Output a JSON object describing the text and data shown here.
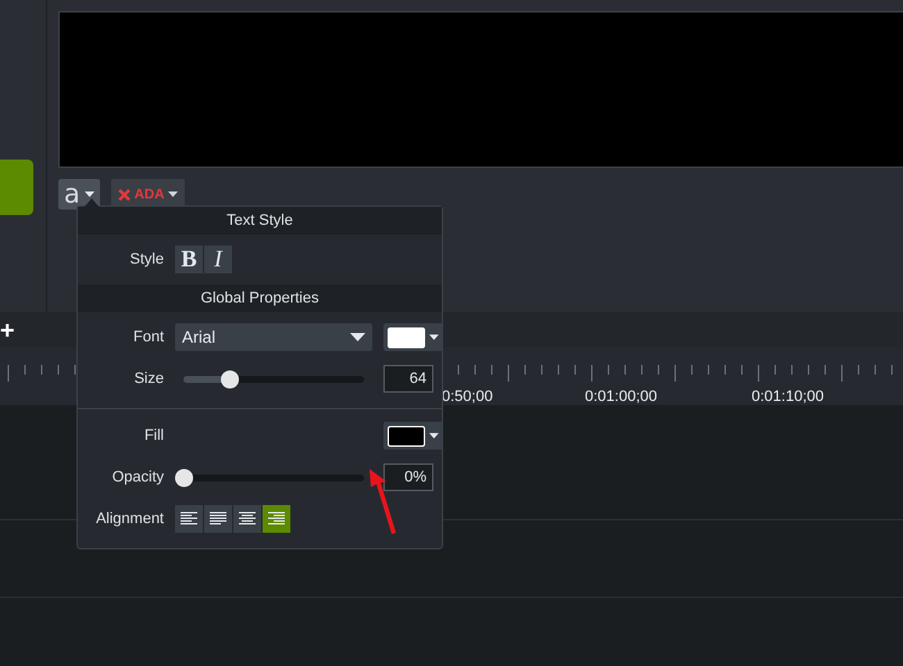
{
  "editor": {
    "annotation_button": {
      "label": "a"
    },
    "ada_button": {
      "label": "ADA"
    }
  },
  "timeline": {
    "add_label": "+",
    "ruler_labels": [
      "0:50;00",
      "0:01:00;00",
      "0:01:10;00"
    ]
  },
  "text_properties": {
    "text_style": {
      "title": "Text Style",
      "style_label": "Style",
      "style_buttons": [
        {
          "label": "B",
          "kind": "bold"
        },
        {
          "label": "I",
          "kind": "italic"
        }
      ]
    },
    "global_properties": {
      "title": "Global Properties",
      "font": {
        "label": "Font",
        "value": "Arial",
        "color": "#ffffff"
      },
      "size": {
        "label": "Size",
        "level": 0.25,
        "value": "64"
      },
      "fill": {
        "label": "Fill",
        "color": "#000000"
      },
      "opacity": {
        "label": "Opacity",
        "level": 0,
        "value": "0%"
      },
      "alignment": {
        "label": "Alignment",
        "options": [
          {
            "kind": "left",
            "selected": false
          },
          {
            "kind": "justify",
            "selected": false
          },
          {
            "kind": "center",
            "selected": false
          },
          {
            "kind": "right",
            "selected": true
          }
        ]
      }
    }
  }
}
